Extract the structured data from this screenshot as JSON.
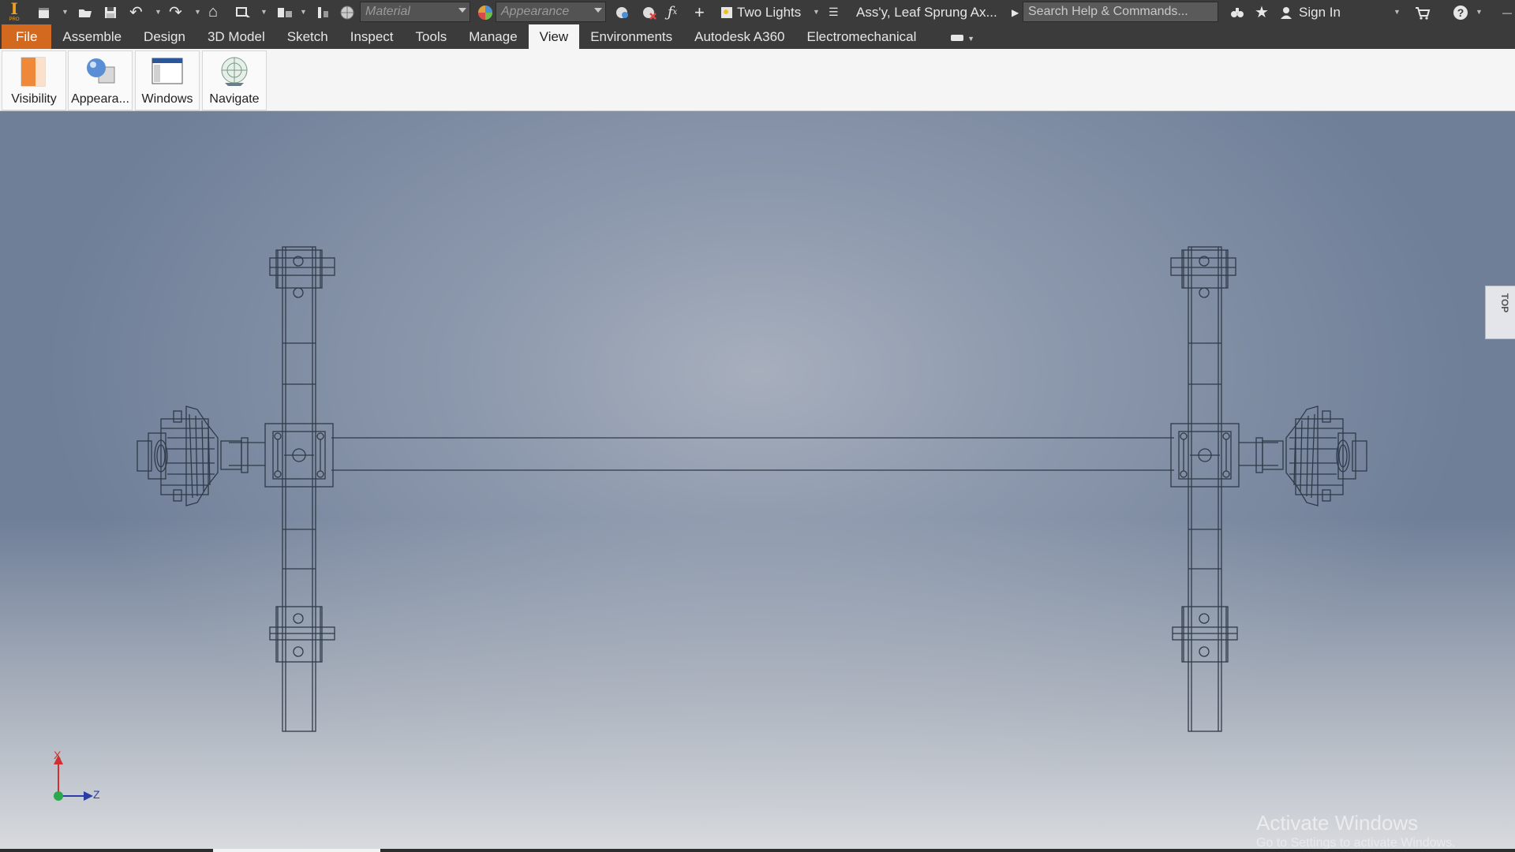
{
  "title_bar": {
    "app_logo": "I",
    "app_logo_sub": "PRO",
    "material_placeholder": "Material",
    "appearance_placeholder": "Appearance",
    "lighting_value": "Two Lights",
    "document_title": "Ass'y, Leaf Sprung Ax...",
    "search_placeholder": "Search Help & Commands...",
    "sign_in_label": "Sign In"
  },
  "tabs": [
    {
      "label": "File"
    },
    {
      "label": "Assemble"
    },
    {
      "label": "Design"
    },
    {
      "label": "3D Model"
    },
    {
      "label": "Sketch"
    },
    {
      "label": "Inspect"
    },
    {
      "label": "Tools"
    },
    {
      "label": "Manage"
    },
    {
      "label": "View"
    },
    {
      "label": "Environments"
    },
    {
      "label": "Autodesk A360"
    },
    {
      "label": "Electromechanical"
    }
  ],
  "ribbon": {
    "buttons": [
      {
        "label": "Visibility",
        "icon": "visibility-icon"
      },
      {
        "label": "Appeara...",
        "icon": "appearance-icon"
      },
      {
        "label": "Windows",
        "icon": "windows-icon"
      },
      {
        "label": "Navigate",
        "icon": "navigate-icon"
      }
    ]
  },
  "viewport": {
    "viewcube_label": "TOP",
    "triad_x_label": "X",
    "triad_z_label": "Z",
    "watermark_title": "Activate Windows",
    "watermark_sub": "Go to Settings to activate Windows."
  },
  "colors": {
    "file_tab": "#d2691e",
    "dark_chrome": "#3b3b3b",
    "wireframe": "#2f3a48"
  }
}
